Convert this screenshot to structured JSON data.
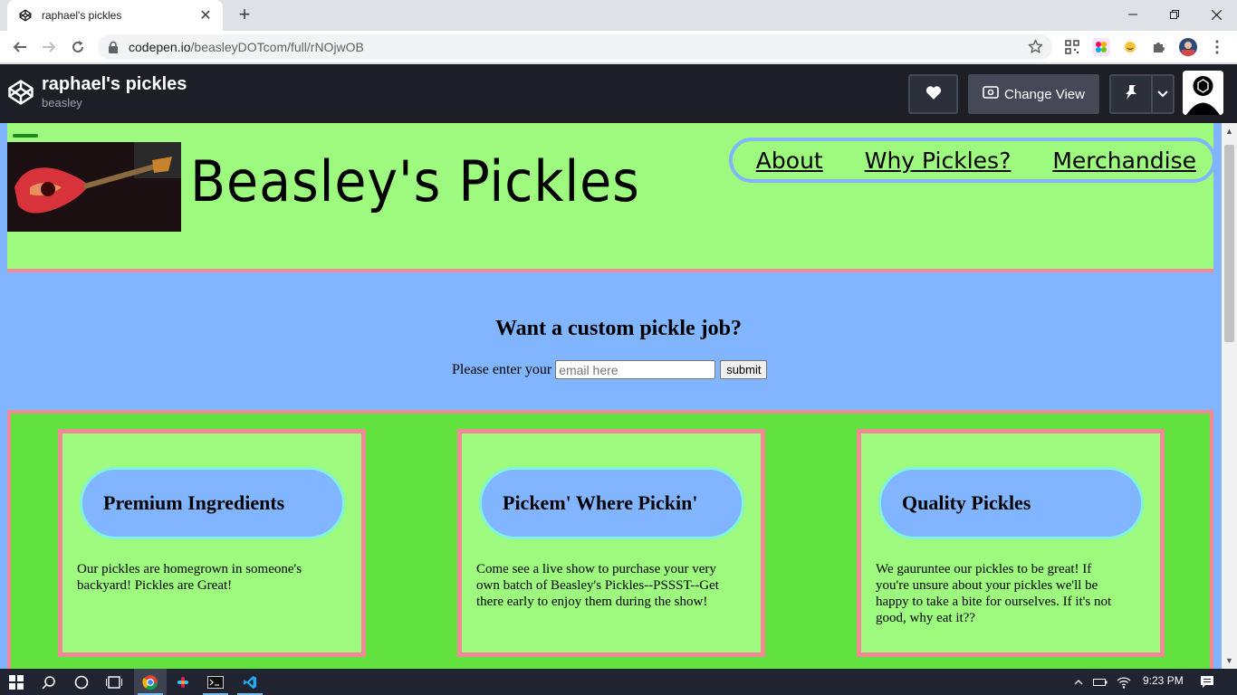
{
  "browser": {
    "tab_title": "raphael's pickles",
    "close_tab": "✕",
    "new_tab": "+",
    "url_host": "codepen.io",
    "url_path": "/beasleyDOTcom/full/rNOjwOB"
  },
  "codepen": {
    "pen_title": "raphael's pickles",
    "author": "beasley",
    "change_view_label": "Change View"
  },
  "site": {
    "brand": "Beasley's Pickles",
    "nav": [
      "About",
      "Why Pickles?",
      "Merchandise"
    ],
    "cta_heading": "Want a custom pickle job?",
    "cta_prompt": "Please enter your",
    "email_placeholder": "email here",
    "submit_label": "submit",
    "cards": [
      {
        "title": "Premium Ingredients",
        "body": "Our pickles are homegrown in someone's backyard! Pickles are Great!"
      },
      {
        "title": "Pickem' Where Pickin'",
        "body": "Come see a live show to purchase your very own batch of Beasley's Pickles--PSSST--Get there early to enjoy them during the show!"
      },
      {
        "title": "Quality Pickles",
        "body": "We gauruntee our pickles to be great! If you're unsure about your pickles we'll be happy to take a bite for ourselves. If it's not good, why eat it??"
      }
    ]
  },
  "taskbar": {
    "time": "9:23 PM"
  },
  "colors": {
    "header_green": "#9dfa7e",
    "feature_green": "#62e23f",
    "page_blue": "#81b5ff",
    "pink_border": "#f18a95",
    "codepen_dark": "#1e1f26"
  }
}
